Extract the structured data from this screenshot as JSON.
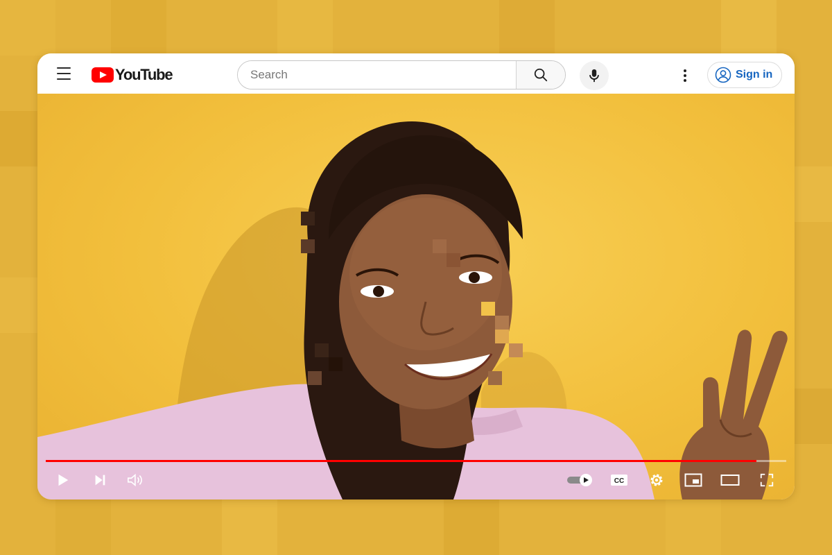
{
  "header": {
    "logo_text": "YouTube",
    "search": {
      "placeholder": "Search",
      "value": ""
    },
    "signin_label": "Sign in"
  },
  "player": {
    "progress_fraction": 0.96,
    "colors": {
      "progress": "#ff0000",
      "accent_brand": "#ff0000",
      "signin_text": "#1565c0",
      "page_background": "#e3b23c"
    },
    "controls_left": [
      "play-icon",
      "next-icon",
      "volume-icon"
    ],
    "controls_right": [
      "autoplay-toggle-icon",
      "subtitles-icon",
      "settings-icon",
      "miniplayer-icon",
      "theater-mode-icon",
      "fullscreen-icon"
    ],
    "subtitles_label": "CC"
  }
}
